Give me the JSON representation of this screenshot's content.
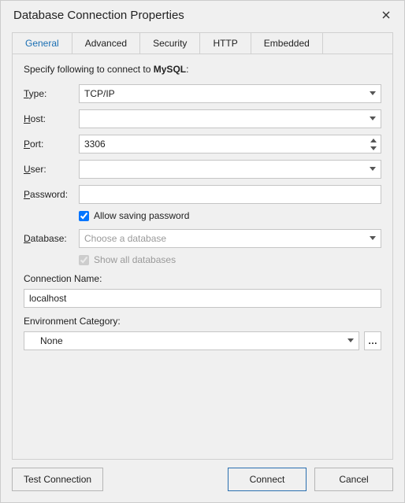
{
  "dialog": {
    "title": "Database Connection Properties"
  },
  "tabs": {
    "general": "General",
    "advanced": "Advanced",
    "security": "Security",
    "http": "HTTP",
    "embedded": "Embedded"
  },
  "intro": {
    "prefix": "Specify following to connect to ",
    "db_engine": "MySQL",
    "suffix": ":"
  },
  "labels": {
    "type_t": "T",
    "type_rest": "ype:",
    "host_h": "H",
    "host_rest": "ost:",
    "port_p": "P",
    "port_rest": "ort:",
    "user_u": "U",
    "user_rest": "ser:",
    "password_p": "P",
    "password_rest": "assword:",
    "database_d": "D",
    "database_rest": "atabase:",
    "conn_name_prefix": "Connection ",
    "conn_name_n": "N",
    "conn_name_rest": "ame:",
    "env_category": "Environment Category:"
  },
  "values": {
    "type": "TCP/IP",
    "host": "",
    "port": "3306",
    "user": "",
    "password": "",
    "database_placeholder": "Choose a database",
    "connection_name": "localhost",
    "env_category": "None"
  },
  "checkboxes": {
    "allow_saving_a": "A",
    "allow_saving_rest": "llow saving password",
    "show_all_s": "S",
    "show_all_rest": "how all databases"
  },
  "buttons": {
    "test_t": "T",
    "test_rest": "est Connection",
    "connect": "Connect",
    "cancel": "Cancel",
    "dots": "…"
  }
}
